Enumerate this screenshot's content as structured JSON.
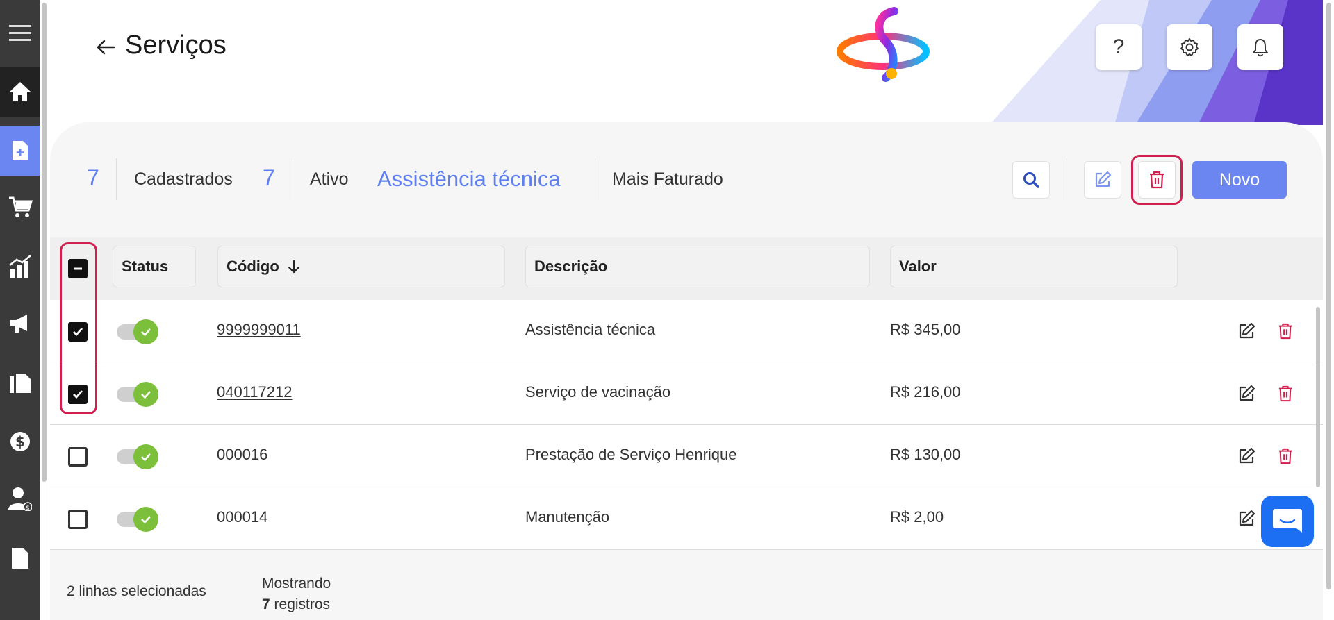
{
  "header": {
    "title": "Serviços",
    "help_label": "?"
  },
  "stats": {
    "cadastrados_count": "7",
    "cadastrados_label": "Cadastrados",
    "ativo_count": "7",
    "ativo_label": "Ativo",
    "highlight_service": "Assistência técnica",
    "highlight_label": "Mais Faturado"
  },
  "toolbar": {
    "new_label": "Novo"
  },
  "table": {
    "columns": {
      "status": "Status",
      "codigo": "Código",
      "descricao": "Descrição",
      "valor": "Valor"
    },
    "rows": [
      {
        "checked": true,
        "active": true,
        "codigo": "9999999011",
        "descricao": "Assistência técnica",
        "valor": "R$ 345,00"
      },
      {
        "checked": true,
        "active": true,
        "codigo": "040117212",
        "descricao": "Serviço de vacinação",
        "valor": "R$ 216,00"
      },
      {
        "checked": false,
        "active": true,
        "codigo": "000016",
        "descricao": "Prestação de Serviço Henrique",
        "valor": "R$ 130,00"
      },
      {
        "checked": false,
        "active": true,
        "codigo": "000014",
        "descricao": "Manutenção",
        "valor": "R$ 2,00"
      }
    ]
  },
  "footer": {
    "selected_text": "2 linhas selecionadas",
    "showing_label": "Mostrando",
    "showing_count": "7",
    "showing_suffix": "registros"
  },
  "colors": {
    "accent": "#6b86f0",
    "danger": "#d11f4f",
    "active_green": "#7bbf3a",
    "sidebar": "#3a3a3a"
  },
  "icons": {
    "sidebar": [
      "menu-icon",
      "home-icon",
      "document-add-icon",
      "cart-icon",
      "chart-icon",
      "megaphone-icon",
      "files-icon",
      "dollar-icon",
      "user-money-icon",
      "file-icon"
    ],
    "header": [
      "back-arrow-icon",
      "help-icon",
      "gear-icon",
      "bell-icon"
    ],
    "toolbar": [
      "search-icon",
      "edit-icon",
      "trash-icon"
    ]
  }
}
